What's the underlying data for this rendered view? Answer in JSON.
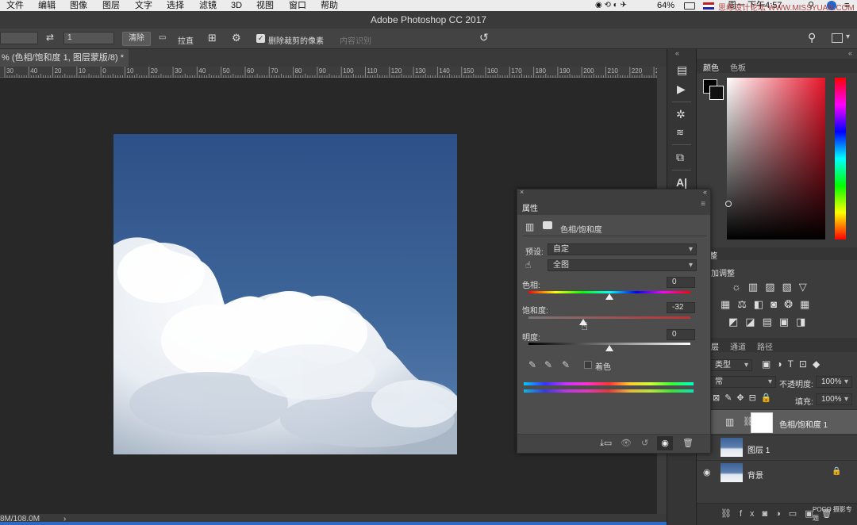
{
  "menubar": {
    "items": [
      "文件",
      "编辑",
      "图像",
      "图层",
      "文字",
      "选择",
      "滤镜",
      "3D",
      "视图",
      "窗口",
      "帮助"
    ],
    "battery": "64%",
    "clock": "周一 下午4:57",
    "watermark": "思缘设计论坛 WWW.MISSYUAN.COM"
  },
  "app": {
    "title": "Adobe Photoshop CC 2017"
  },
  "options": {
    "ratio_value": "1",
    "clear_label": "清除",
    "straighten_label": "拉直",
    "delete_cropped_label": "删除裁剪的像素",
    "content_aware_label": "内容识别"
  },
  "document": {
    "tab_title": "% (色相/饱和度 1, 图层蒙版/8) *",
    "ruler_ticks": [
      "30",
      "40",
      "20",
      "10",
      "0",
      "10",
      "20",
      "30",
      "40",
      "50",
      "60",
      "70",
      "80",
      "90",
      "100",
      "110",
      "120",
      "130",
      "140",
      "150",
      "160",
      "170",
      "180",
      "190",
      "200",
      "210",
      "220",
      "2"
    ]
  },
  "status": {
    "doc_size": "8M/108.0M",
    "arrow": "›"
  },
  "properties": {
    "title": "属性",
    "adj_name": "色相/饱和度",
    "preset_label": "预设:",
    "preset_value": "自定",
    "channel_value": "全图",
    "hue_label": "色相:",
    "hue_value": "0",
    "sat_label": "饱和度:",
    "sat_value": "-32",
    "light_label": "明度:",
    "light_value": "0",
    "colorize_label": "着色",
    "slider_levels": {
      "hue": 0,
      "saturation": -32,
      "lightness": 0,
      "range": [
        -100,
        100
      ]
    }
  },
  "color_panel": {
    "tab_color": "颜色",
    "tab_swatches": "色板",
    "accent": "#e8152a"
  },
  "adjustments": {
    "tab_short": "整",
    "subtitle": "加调整"
  },
  "layers": {
    "tab_layers": "层",
    "tab_channels": "通道",
    "tab_paths": "路径",
    "kind_label": "类型",
    "blend_mode": "常",
    "opacity_label": "不透明度:",
    "opacity_value": "100%",
    "fill_label": "填充:",
    "fill_value": "100%",
    "rows": [
      {
        "name": "色相/饱和度 1",
        "visible": false
      },
      {
        "name": "图层 1",
        "visible": false
      },
      {
        "name": "背景",
        "visible": true
      }
    ],
    "footer_brand": "POCO 摄影专题"
  }
}
